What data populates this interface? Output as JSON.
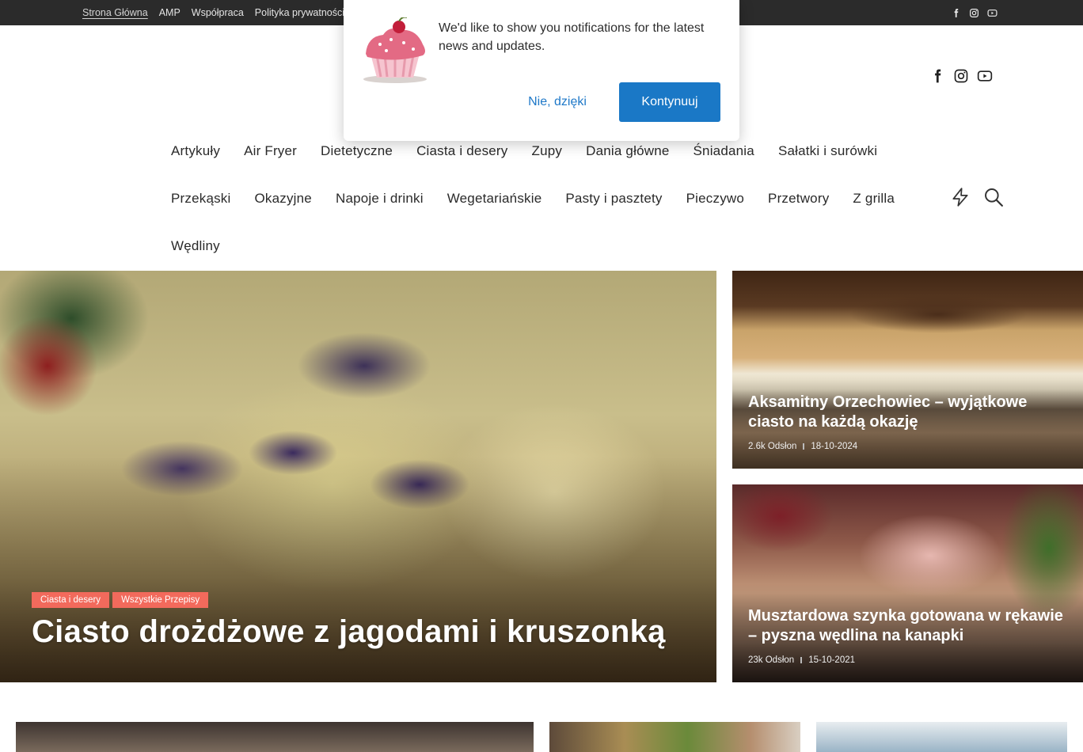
{
  "topbar": {
    "links": [
      "Strona Główna",
      "AMP",
      "Współpraca",
      "Polityka prywatności"
    ],
    "social_icons": [
      "facebook-icon",
      "instagram-icon",
      "youtube-icon"
    ]
  },
  "header": {
    "social_icons": [
      "facebook-icon",
      "instagram-icon",
      "youtube-icon"
    ]
  },
  "popup": {
    "icon": "cupcake-icon",
    "message": "We'd like to show you notifications for the latest news and updates.",
    "decline_label": "Nie, dzięki",
    "accept_label": "Kontynuuj",
    "accent_color": "#1a78c6"
  },
  "nav": {
    "rows": [
      [
        "Artykuły",
        "Air Fryer",
        "Dietetyczne",
        "Ciasta i desery",
        "Zupy",
        "Dania główne",
        "Śniadania",
        "Sałatki i surówki"
      ],
      [
        "Przekąski",
        "Okazyjne",
        "Napoje i drinki",
        "Wegetariańskie",
        "Pasty i pasztety",
        "Pieczywo",
        "Przetwory",
        "Z grilla"
      ],
      [
        "Wędliny"
      ]
    ],
    "tools": [
      "lightning-icon",
      "search-icon"
    ]
  },
  "hero": {
    "main": {
      "tags": [
        "Ciasta i desery",
        "Wszystkie Przepisy"
      ],
      "title": "Ciasto drożdżowe z jagodami i kruszonką",
      "tag_color": "#f26a5c"
    },
    "side": [
      {
        "title": "Aksamitny Orzechowiec – wyjątkowe ciasto na każdą okazję",
        "views": "2.6k Odsłon",
        "date": "18-10-2024"
      },
      {
        "title": "Musztardowa szynka gotowana w rękawie – pyszna wędlina na kanapki",
        "views": "23k Odsłon",
        "date": "15-10-2021"
      }
    ]
  }
}
